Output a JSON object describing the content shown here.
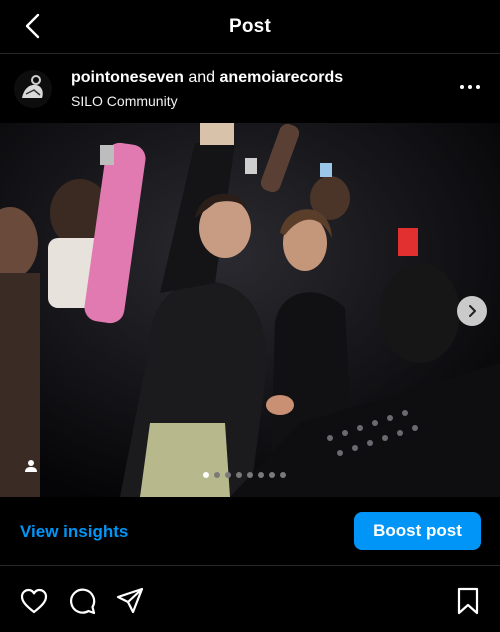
{
  "header": {
    "title": "Post",
    "back_icon": "chevron-left-icon"
  },
  "author": {
    "user1": "pointoneseven",
    "conjunction": "and",
    "user2": "anemoiarecords",
    "subtitle": "SILO Community",
    "more_icon": "more-horizontal-icon"
  },
  "media": {
    "carousel_count": 8,
    "active_index": 0,
    "next_icon": "chevron-right-icon",
    "tag_icon": "person-icon"
  },
  "insights": {
    "label": "View insights",
    "boost_label": "Boost post"
  },
  "actions": {
    "like_icon": "heart-icon",
    "comment_icon": "comment-icon",
    "share_icon": "share-icon",
    "save_icon": "bookmark-icon"
  },
  "colors": {
    "accent": "#0095f6",
    "background": "#000000"
  }
}
